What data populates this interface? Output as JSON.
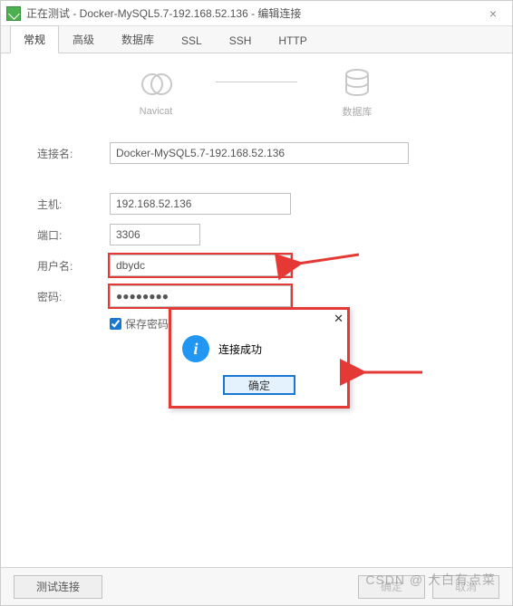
{
  "window": {
    "title": "正在测试 - Docker-MySQL5.7-192.168.52.136 - 编辑连接"
  },
  "tabs": {
    "items": [
      "常规",
      "高级",
      "数据库",
      "SSL",
      "SSH",
      "HTTP"
    ],
    "active": 0
  },
  "diagram": {
    "left": "Navicat",
    "right": "数据库"
  },
  "form": {
    "conn_label": "连接名:",
    "conn_value": "Docker-MySQL5.7-192.168.52.136",
    "host_label": "主机:",
    "host_value": "192.168.52.136",
    "port_label": "端口:",
    "port_value": "3306",
    "user_label": "用户名:",
    "user_value": "dbydc",
    "pass_label": "密码:",
    "pass_value": "●●●●●●●●",
    "save_pw_label": "保存密码"
  },
  "dialog": {
    "msg": "连接成功",
    "ok": "确定"
  },
  "footer": {
    "test": "测试连接",
    "ok": "确定",
    "cancel": "取消"
  },
  "watermark": "CSDN @ 大白有点菜"
}
